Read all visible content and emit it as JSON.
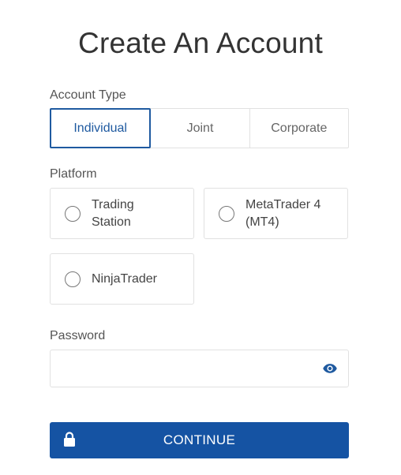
{
  "title": "Create An Account",
  "account_type": {
    "label": "Account Type",
    "options": [
      "Individual",
      "Joint",
      "Corporate"
    ],
    "selected": "Individual"
  },
  "platform": {
    "label": "Platform",
    "options": [
      "Trading\nStation",
      "MetaTrader 4\n(MT4)",
      "NinjaTrader"
    ]
  },
  "password": {
    "label": "Password",
    "value": "",
    "placeholder": ""
  },
  "continue_button": {
    "label": "CONTINUE"
  },
  "colors": {
    "accent": "#1f5aa0",
    "button": "#1553a3",
    "border": "#e1e1e1"
  },
  "icons": {
    "password_toggle": "eye-icon",
    "button": "lock-icon"
  }
}
